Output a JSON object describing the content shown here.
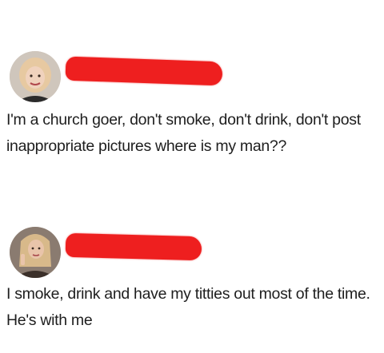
{
  "posts": [
    {
      "avatar_icon": "woman-portrait-icon",
      "author_redacted": true,
      "redaction_color": "#ee1f1f",
      "text": "I'm a church goer, don't smoke, don't drink, don't post inappropriate pictures where is my man??"
    },
    {
      "avatar_icon": "woman-portrait-icon",
      "author_redacted": true,
      "redaction_color": "#ee1f1f",
      "text": "I smoke, drink and have my titties out most of the time. He's with me"
    }
  ]
}
